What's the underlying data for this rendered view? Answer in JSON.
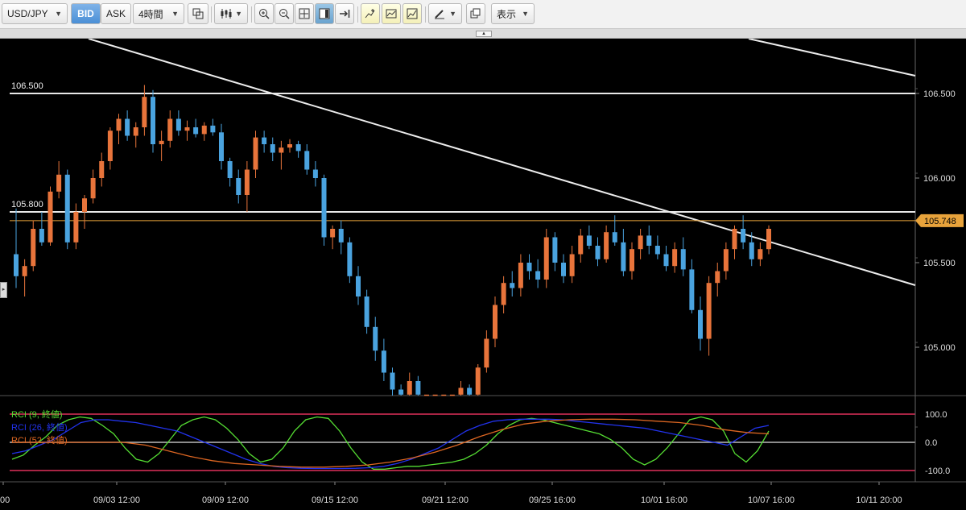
{
  "toolbar": {
    "symbol": "USD/JPY",
    "bid_label": "BID",
    "ask_label": "ASK",
    "timeframe": "4時間",
    "display_menu": "表示"
  },
  "price_axis": {
    "ticks": [
      "106.500",
      "106.000",
      "105.500",
      "105.000"
    ],
    "current_price": "105.748"
  },
  "levels": {
    "upper": "106.500",
    "lower": "105.800"
  },
  "rci_axis": {
    "ticks": [
      "100.0",
      "0.0",
      "-100.0"
    ]
  },
  "legend": [
    {
      "label": "RCI (9, 終値)",
      "color": "#55dd33"
    },
    {
      "label": "RCI (26, 終値)",
      "color": "#2233ee"
    },
    {
      "label": "RCI (52, 終値)",
      "color": "#dd6622"
    }
  ],
  "time_axis": [
    "00",
    "09/03 12:00",
    "09/09 12:00",
    "09/15 12:00",
    "09/21 12:00",
    "09/25 16:00",
    "10/01 16:00",
    "10/07 16:00",
    "10/11 20:00"
  ],
  "colors": {
    "up": "#e8743b",
    "down": "#4aa3df",
    "current_line": "#e8a33b",
    "rci_band": "#e0305a"
  },
  "chart_data": {
    "type": "candlestick",
    "candles": [
      [
        105.55,
        105.82,
        105.35,
        105.42
      ],
      [
        105.42,
        105.52,
        105.3,
        105.48
      ],
      [
        105.48,
        105.75,
        105.45,
        105.7
      ],
      [
        105.7,
        105.8,
        105.6,
        105.62
      ],
      [
        105.62,
        105.95,
        105.6,
        105.92
      ],
      [
        105.92,
        106.1,
        105.88,
        106.02
      ],
      [
        106.02,
        106.05,
        105.58,
        105.62
      ],
      [
        105.62,
        105.85,
        105.58,
        105.8
      ],
      [
        105.8,
        105.9,
        105.7,
        105.88
      ],
      [
        105.88,
        106.05,
        105.85,
        106.0
      ],
      [
        106.0,
        106.15,
        105.95,
        106.1
      ],
      [
        106.1,
        106.3,
        106.05,
        106.28
      ],
      [
        106.28,
        106.38,
        106.2,
        106.35
      ],
      [
        106.35,
        106.4,
        106.22,
        106.25
      ],
      [
        106.25,
        106.33,
        106.18,
        106.3
      ],
      [
        106.3,
        106.55,
        106.25,
        106.48
      ],
      [
        106.48,
        106.52,
        106.15,
        106.2
      ],
      [
        106.2,
        106.28,
        106.1,
        106.22
      ],
      [
        106.22,
        106.4,
        106.18,
        106.35
      ],
      [
        106.35,
        106.4,
        106.25,
        106.28
      ],
      [
        106.28,
        106.34,
        106.22,
        106.3
      ],
      [
        106.3,
        106.35,
        106.24,
        106.26
      ],
      [
        106.26,
        106.33,
        106.22,
        106.31
      ],
      [
        106.31,
        106.35,
        106.25,
        106.27
      ],
      [
        106.27,
        106.32,
        106.05,
        106.1
      ],
      [
        106.1,
        106.12,
        105.95,
        106.0
      ],
      [
        106.0,
        106.05,
        105.85,
        105.9
      ],
      [
        105.9,
        106.1,
        105.8,
        106.05
      ],
      [
        106.05,
        106.28,
        106.0,
        106.24
      ],
      [
        106.24,
        106.28,
        106.15,
        106.2
      ],
      [
        106.2,
        106.24,
        106.1,
        106.15
      ],
      [
        106.15,
        106.22,
        106.05,
        106.18
      ],
      [
        106.18,
        106.23,
        106.15,
        106.2
      ],
      [
        106.2,
        106.22,
        106.12,
        106.16
      ],
      [
        106.16,
        106.2,
        106.02,
        106.05
      ],
      [
        106.05,
        106.1,
        105.95,
        106.0
      ],
      [
        106.0,
        106.02,
        105.6,
        105.65
      ],
      [
        105.65,
        105.72,
        105.58,
        105.7
      ],
      [
        105.7,
        105.75,
        105.55,
        105.62
      ],
      [
        105.62,
        105.65,
        105.38,
        105.42
      ],
      [
        105.42,
        105.48,
        105.25,
        105.3
      ],
      [
        105.3,
        105.34,
        105.08,
        105.12
      ],
      [
        105.12,
        105.18,
        104.92,
        104.98
      ],
      [
        104.98,
        105.05,
        104.8,
        104.85
      ],
      [
        104.85,
        104.88,
        104.7,
        104.75
      ],
      [
        104.75,
        104.78,
        104.7,
        104.72
      ],
      [
        104.72,
        104.85,
        104.7,
        104.8
      ],
      [
        104.8,
        104.83,
        104.7,
        104.72
      ],
      [
        104.72,
        104.72,
        104.72,
        104.72
      ],
      [
        104.72,
        104.72,
        104.72,
        104.72
      ],
      [
        104.72,
        104.72,
        104.72,
        104.72
      ],
      [
        104.72,
        104.72,
        104.72,
        104.72
      ],
      [
        104.72,
        104.8,
        104.7,
        104.76
      ],
      [
        104.76,
        104.78,
        104.7,
        104.72
      ],
      [
        104.72,
        104.9,
        104.7,
        104.88
      ],
      [
        104.88,
        105.1,
        104.85,
        105.05
      ],
      [
        105.05,
        105.3,
        105.0,
        105.25
      ],
      [
        105.25,
        105.42,
        105.2,
        105.38
      ],
      [
        105.38,
        105.45,
        105.3,
        105.35
      ],
      [
        105.35,
        105.55,
        105.3,
        105.5
      ],
      [
        105.5,
        105.55,
        105.4,
        105.45
      ],
      [
        105.45,
        105.52,
        105.35,
        105.4
      ],
      [
        105.4,
        105.7,
        105.35,
        105.65
      ],
      [
        105.65,
        105.68,
        105.45,
        105.5
      ],
      [
        105.5,
        105.55,
        105.38,
        105.42
      ],
      [
        105.42,
        105.6,
        105.38,
        105.55
      ],
      [
        105.55,
        105.7,
        105.5,
        105.66
      ],
      [
        105.66,
        105.72,
        105.58,
        105.6
      ],
      [
        105.6,
        105.65,
        105.48,
        105.52
      ],
      [
        105.52,
        105.72,
        105.5,
        105.68
      ],
      [
        105.68,
        105.78,
        105.6,
        105.62
      ],
      [
        105.62,
        105.7,
        105.42,
        105.45
      ],
      [
        105.45,
        105.62,
        105.4,
        105.58
      ],
      [
        105.58,
        105.7,
        105.52,
        105.66
      ],
      [
        105.66,
        105.72,
        105.55,
        105.6
      ],
      [
        105.6,
        105.66,
        105.52,
        105.55
      ],
      [
        105.55,
        105.6,
        105.45,
        105.48
      ],
      [
        105.48,
        105.62,
        105.44,
        105.58
      ],
      [
        105.58,
        105.65,
        105.42,
        105.46
      ],
      [
        105.46,
        105.52,
        105.2,
        105.22
      ],
      [
        105.22,
        105.3,
        104.98,
        105.05
      ],
      [
        105.05,
        105.42,
        104.95,
        105.38
      ],
      [
        105.38,
        105.5,
        105.3,
        105.45
      ],
      [
        105.45,
        105.62,
        105.4,
        105.58
      ],
      [
        105.58,
        105.72,
        105.52,
        105.7
      ],
      [
        105.7,
        105.78,
        105.58,
        105.62
      ],
      [
        105.62,
        105.68,
        105.48,
        105.52
      ],
      [
        105.52,
        105.62,
        105.48,
        105.58
      ],
      [
        105.58,
        105.72,
        105.55,
        105.7
      ]
    ],
    "rci": [
      {
        "name": "RCI (9, 終値)",
        "values": [
          -60,
          -45,
          -10,
          20,
          60,
          80,
          90,
          85,
          60,
          30,
          -20,
          -60,
          -70,
          -40,
          10,
          60,
          80,
          90,
          80,
          50,
          10,
          -40,
          -70,
          -60,
          -20,
          40,
          80,
          90,
          85,
          40,
          -20,
          -70,
          -95,
          -95,
          -90,
          -85,
          -85,
          -80,
          -75,
          -70,
          -60,
          -40,
          -10,
          30,
          60,
          80,
          85,
          80,
          70,
          60,
          50,
          40,
          30,
          10,
          -20,
          -60,
          -80,
          -60,
          -20,
          30,
          80,
          90,
          80,
          40,
          -40,
          -70,
          -30,
          40
        ]
      },
      {
        "name": "RCI (26, 終値)",
        "values": [
          -40,
          -30,
          -10,
          10,
          40,
          70,
          80,
          80,
          75,
          70,
          60,
          50,
          40,
          20,
          0,
          -20,
          -40,
          -60,
          -75,
          -85,
          -90,
          -92,
          -93,
          -93,
          -93,
          -92,
          -90,
          -85,
          -75,
          -60,
          -40,
          -20,
          10,
          40,
          60,
          75,
          80,
          82,
          82,
          82,
          80,
          75,
          70,
          65,
          60,
          55,
          50,
          40,
          30,
          20,
          10,
          0,
          -10,
          20,
          50,
          60
        ]
      },
      {
        "name": "RCI (52, 終値)",
        "values": [
          0,
          0,
          0,
          0,
          0,
          0,
          -10,
          -30,
          -50,
          -65,
          -75,
          -80,
          -85,
          -88,
          -88,
          -85,
          -80,
          -70,
          -55,
          -35,
          -10,
          20,
          45,
          65,
          75,
          80,
          82,
          82,
          80,
          75,
          70,
          60,
          45,
          35,
          30
        ]
      }
    ]
  }
}
